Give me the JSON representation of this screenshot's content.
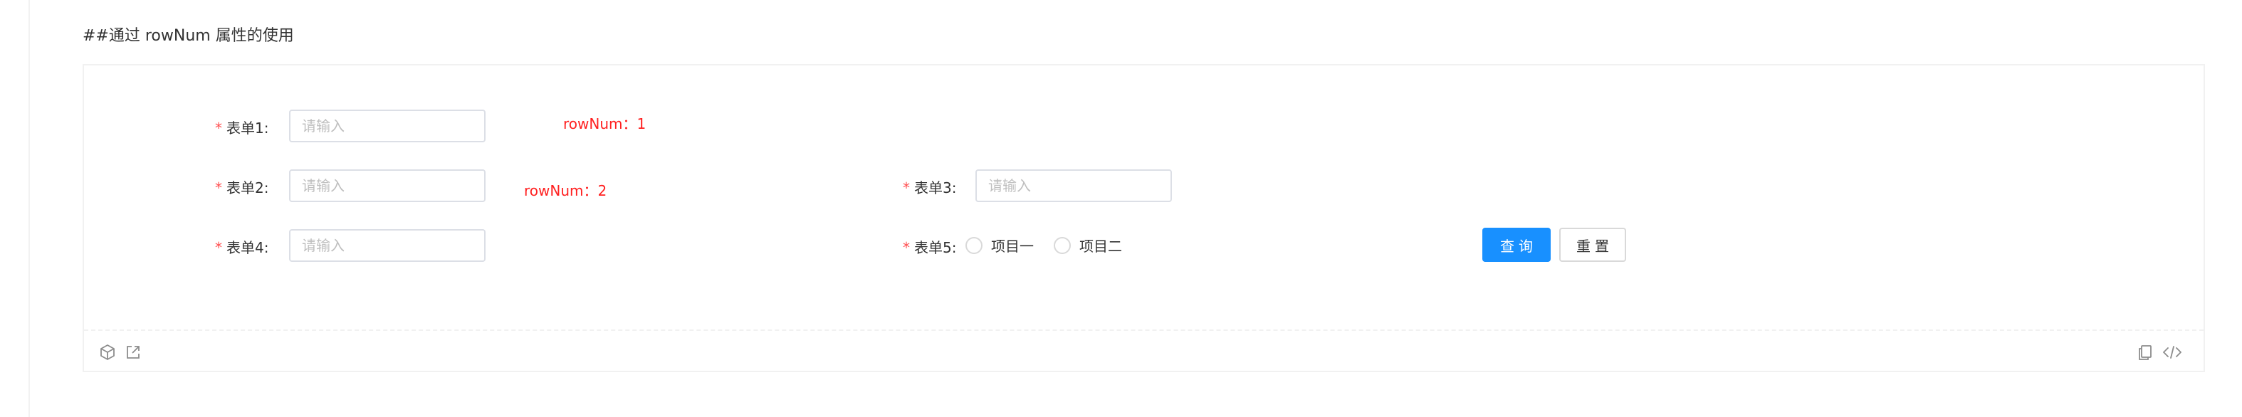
{
  "heading": "##通过 rowNum 属性的使用",
  "form": {
    "fields": [
      {
        "required_mark": "*",
        "label": "表单1:",
        "placeholder": "请输入"
      },
      {
        "required_mark": "*",
        "label": "表单2:",
        "placeholder": "请输入"
      },
      {
        "required_mark": "*",
        "label": "表单3:",
        "placeholder": "请输入"
      },
      {
        "required_mark": "*",
        "label": "表单4:",
        "placeholder": "请输入"
      },
      {
        "required_mark": "*",
        "label": "表单5:"
      }
    ],
    "radio_options": [
      "项目一",
      "项目二"
    ],
    "notes": [
      "rowNum：1",
      "rowNum：2"
    ],
    "buttons": {
      "query": "查询",
      "reset": "重置"
    }
  },
  "footer": {
    "icons": [
      "codesandbox-icon",
      "open-external-icon",
      "copy-icon",
      "code-toggle-icon"
    ]
  },
  "colors": {
    "primary": "#1890ff",
    "required": "#ff4d4f",
    "note": "#ff2020",
    "border": "#dcdfe6"
  }
}
